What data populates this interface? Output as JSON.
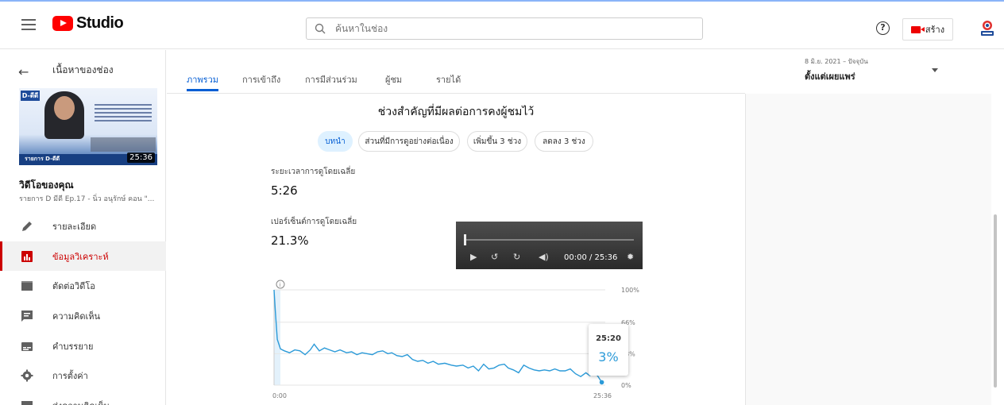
{
  "header": {
    "logo_text": "Studio",
    "search_placeholder": "ค้นหาในช่อง",
    "help_label": "?",
    "create_label": "สร้าง"
  },
  "sidebar": {
    "back_title": "เนื้อหาของช่อง",
    "video": {
      "title": "วิดีโอของคุณ",
      "subtitle": "รายการ D มีดี Ep.17 - นิ่ว อนุรักษ์ คอน \"...",
      "duration": "25:36",
      "thumb_logo": "D-ดีดี",
      "thumb_banner": "รายการ D-ดีดี"
    },
    "items": [
      {
        "label": "รายละเอียด",
        "icon": "pencil-icon"
      },
      {
        "label": "ข้อมูลวิเคราะห์",
        "icon": "analytics-icon"
      },
      {
        "label": "ตัดต่อวิดีโอ",
        "icon": "clapper-icon"
      },
      {
        "label": "ความคิดเห็น",
        "icon": "comment-icon"
      },
      {
        "label": "คำบรรยาย",
        "icon": "subtitles-icon"
      },
      {
        "label": "การตั้งค่า",
        "icon": "gear-icon"
      },
      {
        "label": "ส่งความคิดเห็น",
        "icon": "feedback-icon"
      }
    ]
  },
  "tabs": [
    "ภาพรวม",
    "การเข้าถึง",
    "การมีส่วนร่วม",
    "ผู้ชม",
    "รายได้"
  ],
  "date_range": {
    "range": "8 มิ.ย. 2021 – ปัจจุบัน",
    "label": "ตั้งแต่เผยแพร่"
  },
  "retention": {
    "title": "ช่วงสำคัญที่มีผลต่อการคงผู้ชมไว้",
    "chips": [
      "บทนำ",
      "ส่วนที่มีการดูอย่างต่อเนื่อง",
      "เพิ่มขึ้น 3 ช่วง",
      "ลดลง 3 ช่วง"
    ],
    "avg_view_duration_label": "ระยะเวลาการดูโดยเฉลี่ย",
    "avg_view_duration": "5:26",
    "avg_percentage_label": "เปอร์เซ็นต์การดูโดยเฉลี่ย",
    "avg_percentage": "21.3%",
    "player_time": "00:00 / 25:36",
    "tooltip_time": "25:20",
    "tooltip_value": "3%",
    "accent_color": "#2b9ad8"
  },
  "chart_data": {
    "type": "line",
    "title": "",
    "x_ticks": [
      "0:00",
      "25:36"
    ],
    "y_ticks": [
      "100%",
      "66%",
      "33%",
      "0%"
    ],
    "ylim": [
      0,
      100
    ],
    "xlim": [
      0,
      25.6
    ],
    "series": [
      {
        "values": [
          [
            0,
            100
          ],
          [
            0.1,
            78
          ],
          [
            0.25,
            48
          ],
          [
            0.5,
            38
          ],
          [
            0.8,
            36
          ],
          [
            1.2,
            34
          ],
          [
            1.6,
            37
          ],
          [
            2.0,
            36
          ],
          [
            2.4,
            32
          ],
          [
            2.8,
            37
          ],
          [
            3.1,
            43
          ],
          [
            3.5,
            36
          ],
          [
            3.9,
            39
          ],
          [
            4.3,
            37
          ],
          [
            4.7,
            35
          ],
          [
            5.1,
            37
          ],
          [
            5.6,
            34
          ],
          [
            6.0,
            35
          ],
          [
            6.4,
            32
          ],
          [
            6.8,
            34
          ],
          [
            7.2,
            33
          ],
          [
            7.6,
            32
          ],
          [
            8.0,
            35
          ],
          [
            8.4,
            36
          ],
          [
            8.8,
            33
          ],
          [
            9.1,
            34
          ],
          [
            9.5,
            31
          ],
          [
            9.9,
            30
          ],
          [
            10.3,
            32
          ],
          [
            10.7,
            27
          ],
          [
            11.1,
            25
          ],
          [
            11.5,
            26
          ],
          [
            11.9,
            23
          ],
          [
            12.3,
            25
          ],
          [
            12.7,
            22
          ],
          [
            13.2,
            23
          ],
          [
            13.7,
            21
          ],
          [
            14.1,
            20
          ],
          [
            14.6,
            21
          ],
          [
            15.0,
            18
          ],
          [
            15.4,
            20
          ],
          [
            15.8,
            15
          ],
          [
            16.2,
            22
          ],
          [
            16.6,
            17
          ],
          [
            17.0,
            18
          ],
          [
            17.4,
            21
          ],
          [
            17.8,
            22
          ],
          [
            18.1,
            18
          ],
          [
            18.5,
            16
          ],
          [
            18.9,
            13
          ],
          [
            19.3,
            21
          ],
          [
            19.7,
            18
          ],
          [
            20.1,
            16
          ],
          [
            20.5,
            15
          ],
          [
            20.9,
            16
          ],
          [
            21.3,
            15
          ],
          [
            21.7,
            17
          ],
          [
            22.1,
            15
          ],
          [
            22.5,
            15
          ],
          [
            22.9,
            17
          ],
          [
            23.3,
            12
          ],
          [
            23.7,
            9
          ],
          [
            24.1,
            13
          ],
          [
            24.4,
            10
          ],
          [
            24.7,
            12
          ],
          [
            25.0,
            10
          ],
          [
            25.33,
            3
          ]
        ]
      }
    ]
  }
}
